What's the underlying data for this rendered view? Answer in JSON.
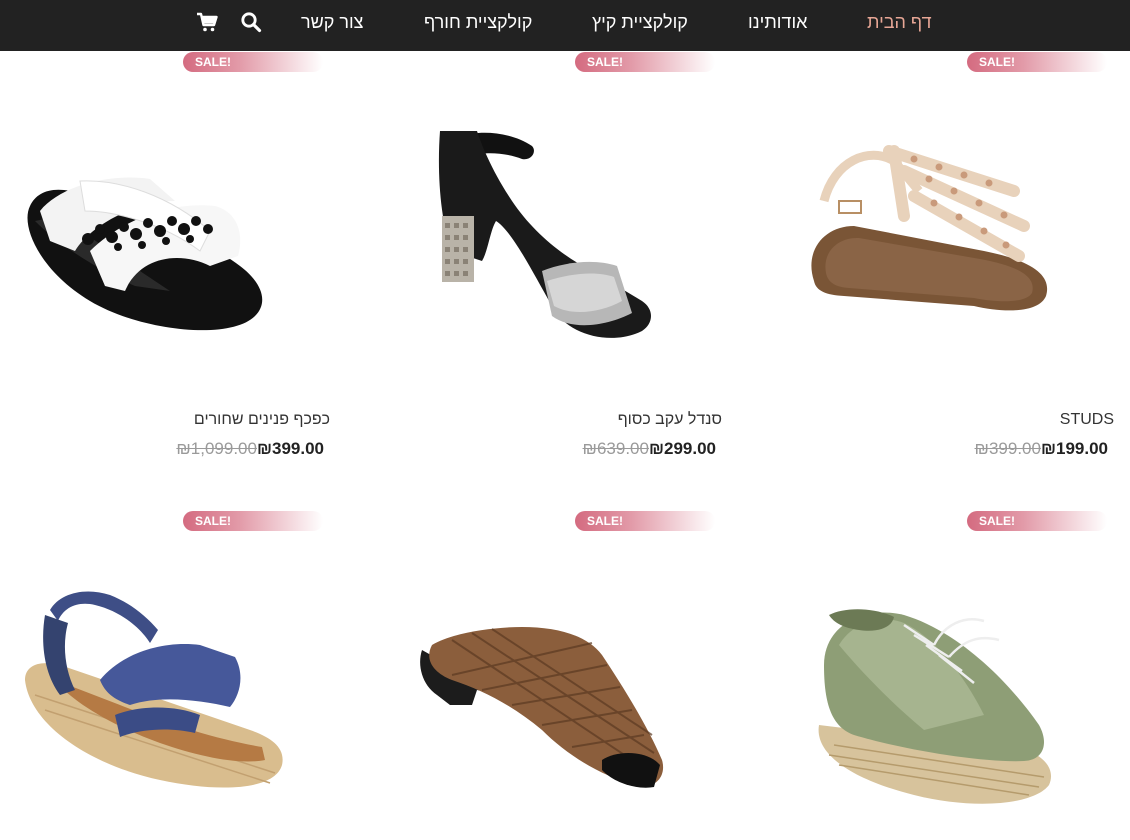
{
  "nav": {
    "items": [
      {
        "label": "דף הבית",
        "active": true
      },
      {
        "label": "אודותינו",
        "active": false
      },
      {
        "label": "קולקציית קיץ",
        "active": false
      },
      {
        "label": "קולקציית חורף",
        "active": false
      },
      {
        "label": "צור קשר",
        "active": false
      }
    ],
    "icons": [
      "search-icon",
      "cart-icon"
    ]
  },
  "sale_badge": "SALE!",
  "products": [
    {
      "title": "STUDS",
      "old_price": "₪399.00",
      "new_price": "₪199.00",
      "image": "beige studded gladiator sandal"
    },
    {
      "title": "סנדל עקב כסוף",
      "old_price": "₪639.00",
      "new_price": "₪299.00",
      "image": "black and silver block-heel sandal"
    },
    {
      "title": "כפכף פנינים שחורים",
      "old_price": "₪1,099.00",
      "new_price": "₪399.00",
      "image": "black and white pearl slide"
    },
    {
      "title": "",
      "old_price": "",
      "new_price": "",
      "image": "green espadrille sneaker"
    },
    {
      "title": "",
      "old_price": "",
      "new_price": "",
      "image": "brown woven mule"
    },
    {
      "title": "",
      "old_price": "",
      "new_price": "",
      "image": "blue metallic espadrille sandal"
    }
  ],
  "colors": {
    "header_bg": "#222222",
    "nav_active": "#e8a796",
    "sale_badge": "#d46b80",
    "old_price": "#9a9a9a"
  }
}
